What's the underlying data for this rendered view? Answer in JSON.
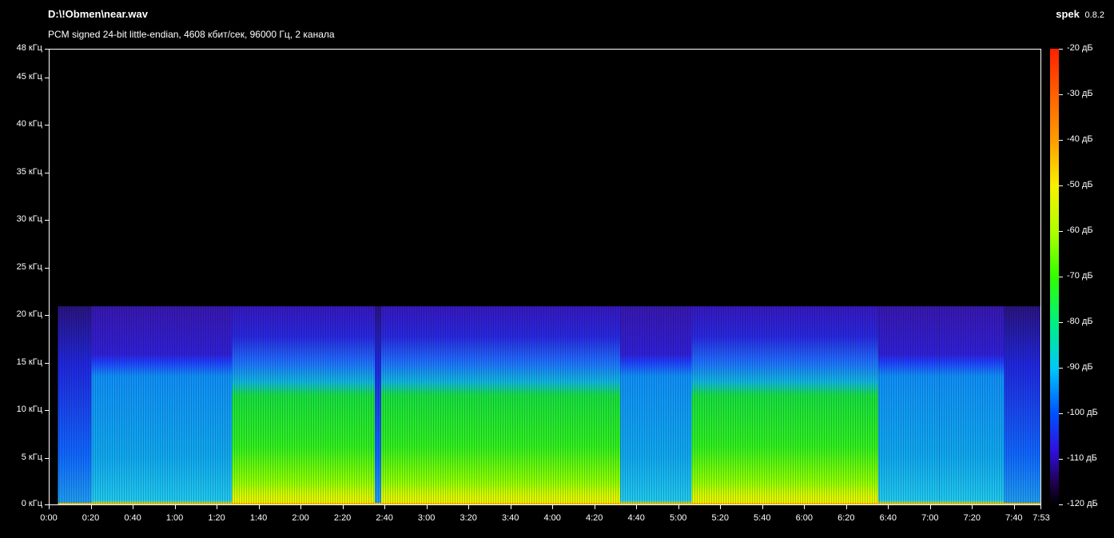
{
  "header": {
    "file_path": "D:\\!Obmen\\near.wav",
    "stream_info": "PCM signed 24-bit little-endian, 4608 кбит/сек, 96000 Гц, 2 канала",
    "app_name": "spek",
    "app_version": "0.8.2"
  },
  "chart_data": {
    "type": "heatmap",
    "title": "D:\\!Obmen\\near.wav",
    "x_unit": "time (m:ss)",
    "y_unit": "кГц",
    "xlim": [
      "0:00",
      "7:53"
    ],
    "ylim": [
      0,
      48
    ],
    "x_ticks": [
      "0:00",
      "0:20",
      "0:40",
      "1:00",
      "1:20",
      "1:40",
      "2:00",
      "2:20",
      "2:40",
      "3:00",
      "3:20",
      "3:40",
      "4:00",
      "4:20",
      "4:40",
      "5:00",
      "5:20",
      "5:40",
      "6:00",
      "6:20",
      "6:40",
      "7:00",
      "7:20",
      "7:40",
      "7:53"
    ],
    "y_ticks": [
      "0 кГц",
      "5 кГц",
      "10 кГц",
      "15 кГц",
      "20 кГц",
      "25 кГц",
      "30 кГц",
      "35 кГц",
      "40 кГц",
      "45 кГц",
      "48 кГц"
    ],
    "colorbar_ticks": [
      "-20 дБ",
      "-30 дБ",
      "-40 дБ",
      "-50 дБ",
      "-60 дБ",
      "-70 дБ",
      "-80 дБ",
      "-90 дБ",
      "-100 дБ",
      "-110 дБ",
      "-120 дБ"
    ],
    "colorbar_range_db": [
      -120,
      -20
    ],
    "frequency_cutoff_khz": 21,
    "segments": [
      {
        "start_s": 0,
        "end_s": 4,
        "top_khz": 0,
        "level": "silence"
      },
      {
        "start_s": 4,
        "end_s": 20,
        "top_khz": 21,
        "level": "low"
      },
      {
        "start_s": 20,
        "end_s": 87,
        "top_khz": 21,
        "level": "medium"
      },
      {
        "start_s": 87,
        "end_s": 155,
        "top_khz": 21,
        "level": "high"
      },
      {
        "start_s": 155,
        "end_s": 158,
        "top_khz": 21,
        "level": "low"
      },
      {
        "start_s": 158,
        "end_s": 272,
        "top_khz": 21,
        "level": "high"
      },
      {
        "start_s": 272,
        "end_s": 306,
        "top_khz": 21,
        "level": "medium"
      },
      {
        "start_s": 306,
        "end_s": 395,
        "top_khz": 21,
        "level": "high"
      },
      {
        "start_s": 395,
        "end_s": 424,
        "top_khz": 21,
        "level": "medium"
      },
      {
        "start_s": 424,
        "end_s": 455,
        "top_khz": 21,
        "level": "medium"
      },
      {
        "start_s": 455,
        "end_s": 473,
        "top_khz": 21,
        "level": "low"
      }
    ],
    "grid": false,
    "legend": "right"
  }
}
